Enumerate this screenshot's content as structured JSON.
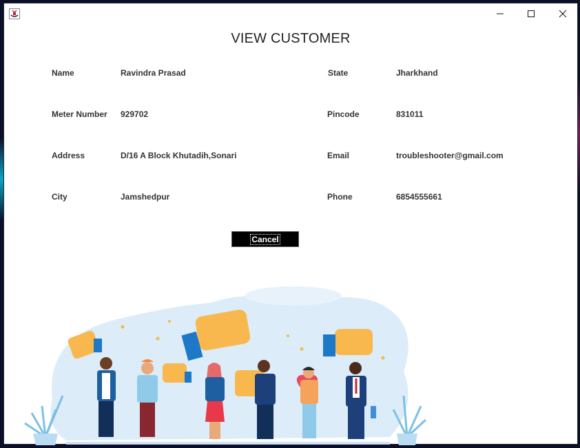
{
  "window": {
    "title": "VIEW CUSTOMER",
    "controls": [
      "minimize",
      "maximize",
      "close"
    ]
  },
  "fields_left": [
    {
      "label": "Name",
      "value": "Ravindra Prasad"
    },
    {
      "label": "Meter Number",
      "value": "929702"
    },
    {
      "label": "Address",
      "value": "D/16 A Block Khutadih,Sonari"
    },
    {
      "label": "City",
      "value": "Jamshedpur"
    }
  ],
  "fields_right": [
    {
      "label": "State",
      "value": "Jharkhand"
    },
    {
      "label": "Pincode",
      "value": "831011"
    },
    {
      "label": "Email",
      "value": "troubleshooter@gmail.com"
    },
    {
      "label": "Phone",
      "value": "6854555661"
    }
  ],
  "buttons": {
    "cancel": "Cancel"
  },
  "colors": {
    "accent_yellow": "#f8b84e",
    "accent_blue": "#1e78c8",
    "button_bg": "#000000"
  },
  "icons": [
    "java-app-icon",
    "minimize-icon",
    "maximize-icon",
    "close-icon"
  ]
}
